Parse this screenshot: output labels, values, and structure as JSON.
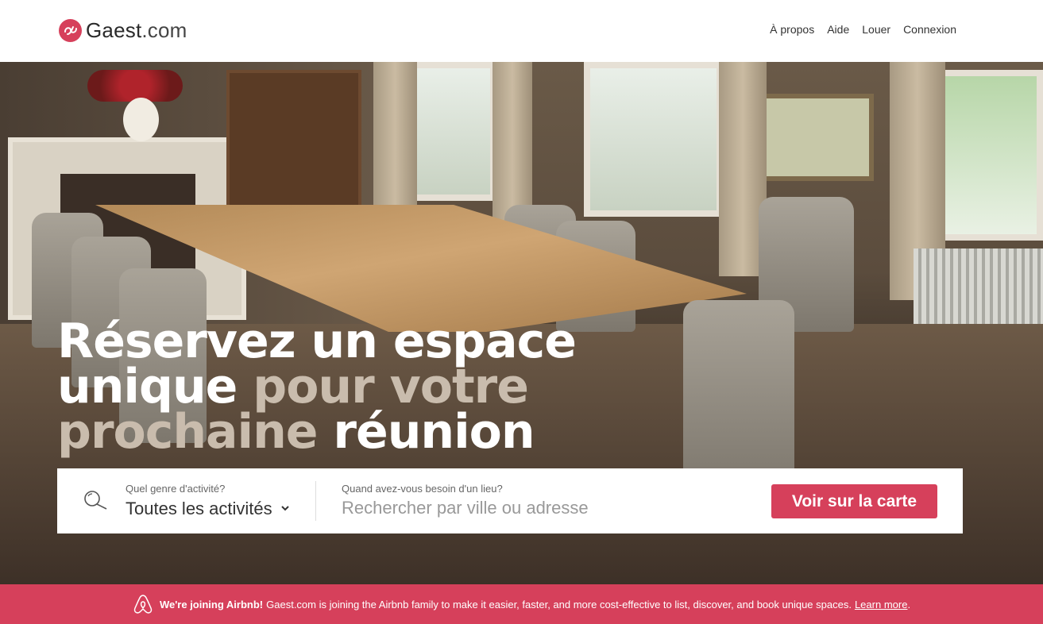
{
  "header": {
    "logo_text_main": "Gaest",
    "logo_text_suffix": ".com",
    "nav": [
      "À propos",
      "Aide",
      "Louer",
      "Connexion"
    ]
  },
  "hero": {
    "headline_line1": "Réservez un espace",
    "headline_line2_a": "unique",
    "headline_line2_b": "pour votre",
    "headline_line3_a": "prochaine",
    "headline_line3_b": "réunion"
  },
  "search": {
    "activity_label": "Quel genre d'activité?",
    "activity_value": "Toutes les activités",
    "where_label": "Quand avez-vous besoin d'un lieu?",
    "where_placeholder": "Rechercher par ville ou adresse",
    "map_button": "Voir sur la carte"
  },
  "banner": {
    "strong": "We're joining Airbnb!",
    "text": "Gaest.com is joining the Airbnb family to make it easier, faster, and more cost-effective to list, discover, and book unique spaces.",
    "link": "Learn more"
  },
  "colors": {
    "brand": "#d6405b"
  }
}
